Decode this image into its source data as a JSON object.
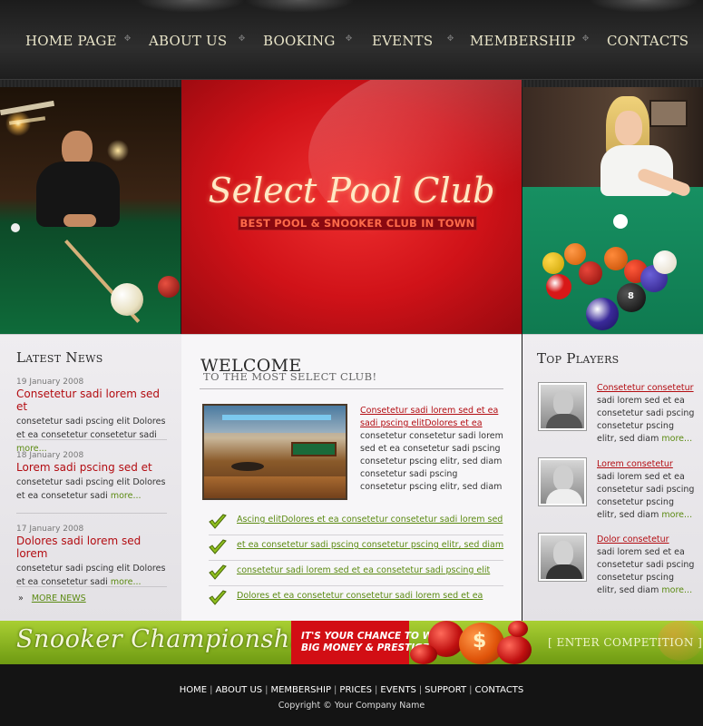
{
  "nav": {
    "items": [
      "HOME PAGE",
      "ABOUT US",
      "BOOKING",
      "EVENTS",
      "MEMBERSHIP",
      "CONTACTS"
    ]
  },
  "banner": {
    "logo": "Select Pool Club",
    "tagline": "BEST POOL & SNOOKER CLUB IN TOWN",
    "right_ball_number": "8"
  },
  "news": {
    "heading": "Latest News",
    "items": [
      {
        "date": "19 January 2008",
        "title": "Consetetur sadi lorem sed et",
        "text": "consetetur sadi pscing elit Dolores et ea consetetur consetetur sadi",
        "more": "more..."
      },
      {
        "date": "18 January 2008",
        "title": "Lorem sadi pscing sed et",
        "text": "consetetur sadi pscing elit Dolores et ea consetetur sadi",
        "more": "more..."
      },
      {
        "date": "17 January 2008",
        "title": "Dolores sadi lorem sed lorem",
        "text": "consetetur sadi pscing elit Dolores et ea consetetur sadi",
        "more": "more..."
      }
    ],
    "more_news_marker": "»",
    "more_news": "MORE NEWS"
  },
  "welcome": {
    "title": "WELCOME",
    "subtitle": "TO THE MOST SELECT CLUB!",
    "link": "Consetetur sadi lorem sed et ea sadi pscing elitDolores et ea",
    "text": "consetetur consetetur sadi lorem sed et ea consetetur sadi pscing consetetur pscing elitr, sed diam consetetur sadi pscing consetetur pscing elitr, sed diam",
    "list": [
      "Ascing elitDolores et ea consetetur consetetur sadi lorem sed",
      "et ea consetetur sadi pscing consetetur pscing elitr, sed diam",
      "consetetur sadi lorem sed  et ea consetetur sadi pscing elit",
      "Dolores et ea consetetur consetetur sadi lorem sed  et ea"
    ]
  },
  "players": {
    "heading": "Top Players",
    "items": [
      {
        "name": "Consetetur consetetur",
        "text": "sadi lorem sed  et ea consetetur sadi pscing consetetur pscing elitr, sed diam",
        "more": "more..."
      },
      {
        "name": "Lorem consetetur",
        "text": "sadi lorem sed  et ea consetetur sadi pscing consetetur pscing elitr, sed diam",
        "more": "more..."
      },
      {
        "name": "Dolor consetetur",
        "text": "sadi lorem sed  et ea consetetur sadi pscing consetetur pscing elitr, sed diam",
        "more": "more..."
      }
    ]
  },
  "promo": {
    "title": "Snooker Championships",
    "line1": "IT'S YOUR CHANCE TO WIN",
    "line2": "BIG MONEY & PRESTIGE",
    "coin": "$",
    "enter": "[ ENTER COMPETITION ]"
  },
  "footer": {
    "links": [
      "HOME",
      "ABOUT US",
      "MEMBERSHIP",
      "PRICES",
      "EVENTS",
      "SUPPORT",
      "CONTACTS"
    ],
    "link_separator": "|",
    "copyright": "Copyright © Your Company Name"
  },
  "colors": {
    "accent_red": "#b30d12",
    "accent_green": "#5b8a12",
    "banner_red": "#d01218",
    "promo_green": "#8fb822"
  }
}
